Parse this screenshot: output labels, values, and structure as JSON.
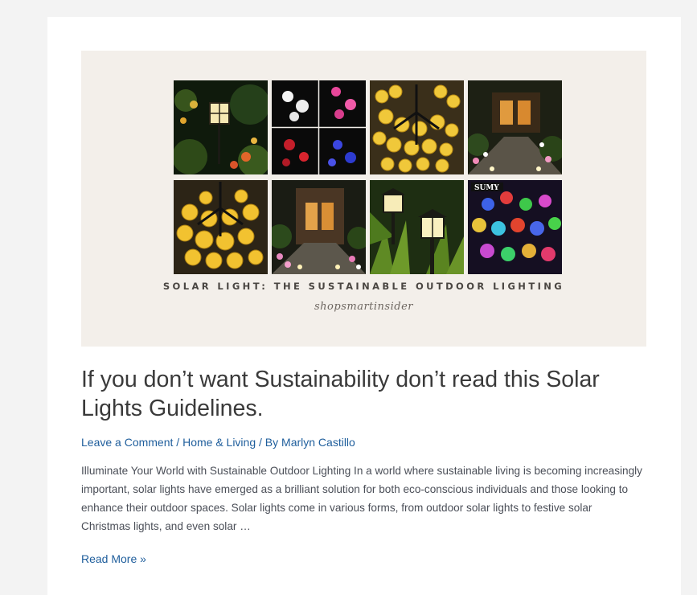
{
  "banner": {
    "caption": "SOLAR LIGHT: THE SUSTAINABLE OUTDOOR LIGHTING",
    "signature": "shopsmartinsider",
    "tile_brand": "SUMY"
  },
  "post": {
    "title": "If you don’t want Sustainability don’t read this Solar Lights Guidelines.",
    "meta": {
      "comment_link": "Leave a Comment",
      "separator1": " / ",
      "category_link": "Home & Living",
      "separator2": " / By ",
      "author_link": "Marlyn Castillo"
    },
    "excerpt": "Illuminate Your World with Sustainable Outdoor Lighting In a world where sustainable living is becoming increasingly important, solar lights have emerged as a brilliant solution for both eco-conscious individuals and those looking to enhance their outdoor spaces. Solar lights come in various forms, from outdoor solar lights to festive solar Christmas lights, and even solar …",
    "read_more": "Read More »"
  },
  "colors": {
    "link": "#1f5e9c",
    "title": "#3a3a3a",
    "body_text": "#4b4f58",
    "banner_bg": "#f3efea"
  }
}
